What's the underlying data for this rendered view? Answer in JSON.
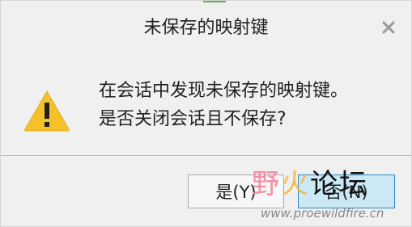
{
  "dialog": {
    "title": "未保存的映射键",
    "message_line1": "在会话中发现未保存的映射键。",
    "message_line2": "是否关闭会话且不保存?",
    "icons": {
      "warning": "warning-icon",
      "close": "close-icon"
    }
  },
  "buttons": {
    "yes_label": "是(Y)",
    "no_label": "否(N)"
  },
  "watermark": {
    "chars": [
      "野",
      "火",
      "论",
      "坛"
    ],
    "url": "www.proewildfire.cn"
  },
  "colors": {
    "warning": "#f4c12b",
    "primary_button": "#cbe8f6",
    "primary_border": "#2b86c5"
  }
}
